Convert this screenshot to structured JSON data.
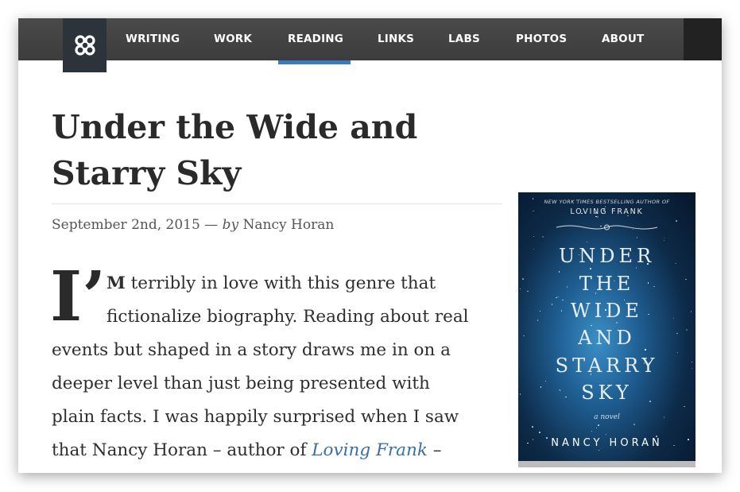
{
  "nav": {
    "items": [
      {
        "label": "WRITING"
      },
      {
        "label": "WORK"
      },
      {
        "label": "READING"
      },
      {
        "label": "LINKS"
      },
      {
        "label": "LABS"
      },
      {
        "label": "PHOTOS"
      },
      {
        "label": "ABOUT"
      }
    ],
    "active": "READING",
    "logo_icon": "knot-logo-icon",
    "accent_color": "#3a7bbf"
  },
  "article": {
    "title_line1": "Under the Wide and",
    "title_line2": "Starry Sky",
    "date": "September 2nd, 2015",
    "dash": "—",
    "by": "by",
    "author": "Nancy Horan",
    "dropcap": "I’",
    "lines": [
      {
        "lead": "M",
        "text": " terribly in love with this genre that"
      },
      {
        "text": "fictionalize biography. Reading about real"
      },
      {
        "text": "events but shaped in a story draws me in on a"
      },
      {
        "text": "deeper level than just being presented with"
      },
      {
        "text": "plain facts. I was happily surprised when I saw"
      },
      {
        "text_before": "that Nancy Horan – author of ",
        "link": "Loving Frank",
        "text_after": " –"
      }
    ]
  },
  "book_cover": {
    "top_line": "NEW YORK TIMES BESTSELLING AUTHOR OF",
    "subtitle": "LOVING FRANK",
    "title_lines": [
      "UNDER",
      "THE",
      "WIDE",
      "AND",
      "STARRY",
      "SKY"
    ],
    "novel": "a novel",
    "author": "NANCY HORAN"
  }
}
